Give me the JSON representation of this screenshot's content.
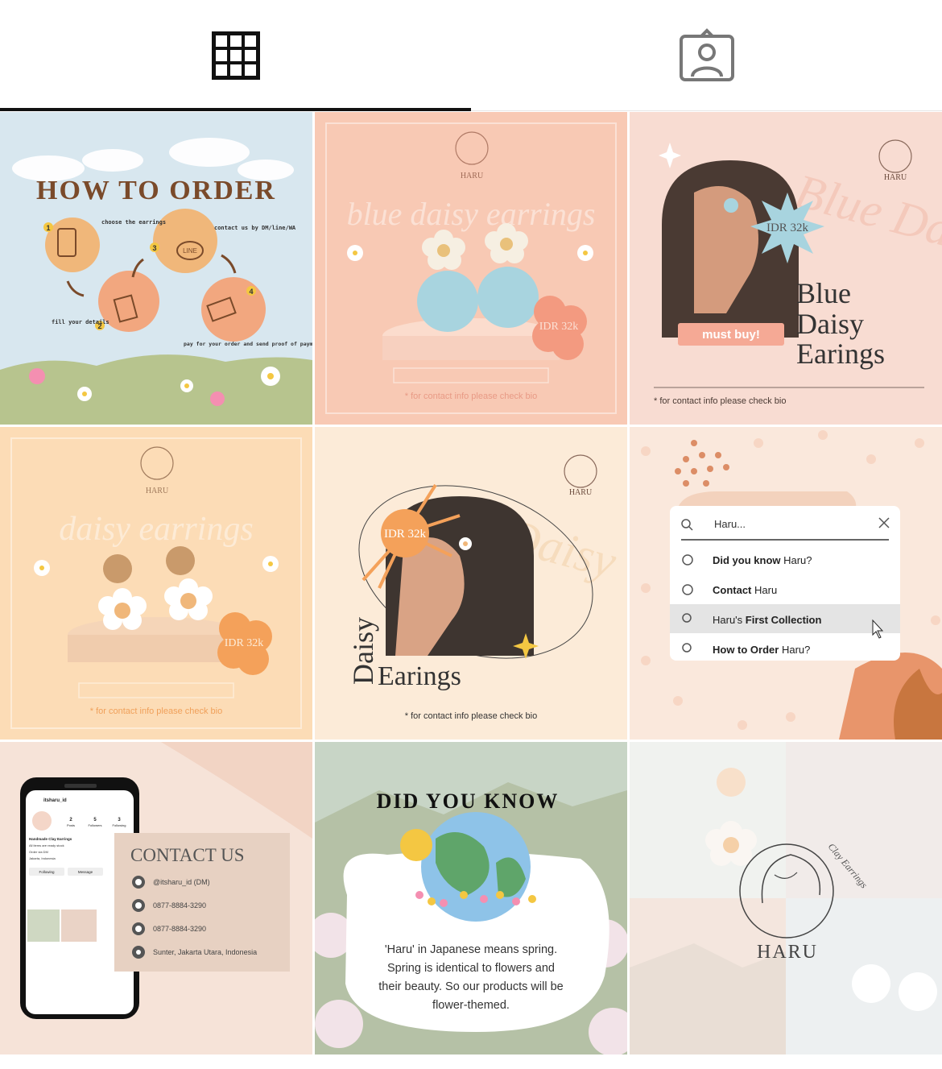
{
  "tabs": [
    {
      "name": "grid",
      "icon": "grid-icon",
      "active": true
    },
    {
      "name": "tagged",
      "icon": "tagged-person-icon",
      "active": false
    }
  ],
  "posts": {
    "p1": {
      "title": "HOW TO ORDER",
      "step1_num": "1",
      "step2_num": "2",
      "step3_num": "3",
      "step4_num": "4",
      "step_choose": "choose the earrings",
      "step_contact": "contact us by DM/line/WA",
      "step_fill": "fill your details",
      "step_pay": "pay for your order and send proof of payment",
      "line_logo": "LINE"
    },
    "p2": {
      "brand": "HARU",
      "script_title": "blue daisy earrings",
      "price": "IDR 32k",
      "footer": "* for contact info please check bio"
    },
    "p3": {
      "brand": "HARU",
      "price": "IDR 32k",
      "badge": "must buy!",
      "title_line1": "Blue",
      "title_line2": "Daisy",
      "title_line3": "Earings",
      "footer": "* for contact info please check bio"
    },
    "p4": {
      "brand": "HARU",
      "script_title": "daisy earrings",
      "price": "IDR 32k",
      "footer": "* for contact info please check bio"
    },
    "p5": {
      "brand": "HARU",
      "price": "IDR 32k",
      "vertical_title": "Daisy",
      "title": "Earings",
      "footer": "* for contact info please check bio"
    },
    "p6": {
      "search_query": "Haru...",
      "item1_bold": "Did you know",
      "item1_rest": " Haru?",
      "item2_bold": "Contact",
      "item2_rest": " Haru",
      "item3_rest": "Haru's ",
      "item3_bold": "First Collection",
      "item4_bold": "How to Order",
      "item4_rest": " Haru?"
    },
    "p7": {
      "phone_username": "itsharu_id",
      "phone_stats": [
        "2",
        "5",
        "3"
      ],
      "phone_stat_labels": [
        "Posts",
        "Followers",
        "Following"
      ],
      "phone_bio1": "Handmade Clay Earrings",
      "phone_bio2": "All items are ready stock",
      "phone_bio3": "Order via DM",
      "phone_bio4": "Jakarta, Indonesia",
      "phone_btn1": "Following",
      "phone_btn2": "Message",
      "title": "CONTACT US",
      "instagram": "@itsharu_id (DM)",
      "whatsapp": "0877-8884-3290",
      "line": "0877-8884-3290",
      "address": "Sunter, Jakarta Utara, Indonesia"
    },
    "p8": {
      "title": "DID YOU KNOW",
      "text_line1": "'Haru' in Japanese means spring.",
      "text_line2": "Spring is identical to flowers and",
      "text_line3": "their beauty. So our products will be",
      "text_line4": "flower-themed."
    },
    "p9": {
      "brand": "HARU",
      "script": "Clay Earrings"
    }
  },
  "colors": {
    "peach": "#f8cbb7",
    "cream": "#fbe4c9",
    "sky": "#d6e5ee",
    "orange": "#f4a15a",
    "brown": "#8b5a3c",
    "daisy_blue": "#a9d6e0"
  }
}
